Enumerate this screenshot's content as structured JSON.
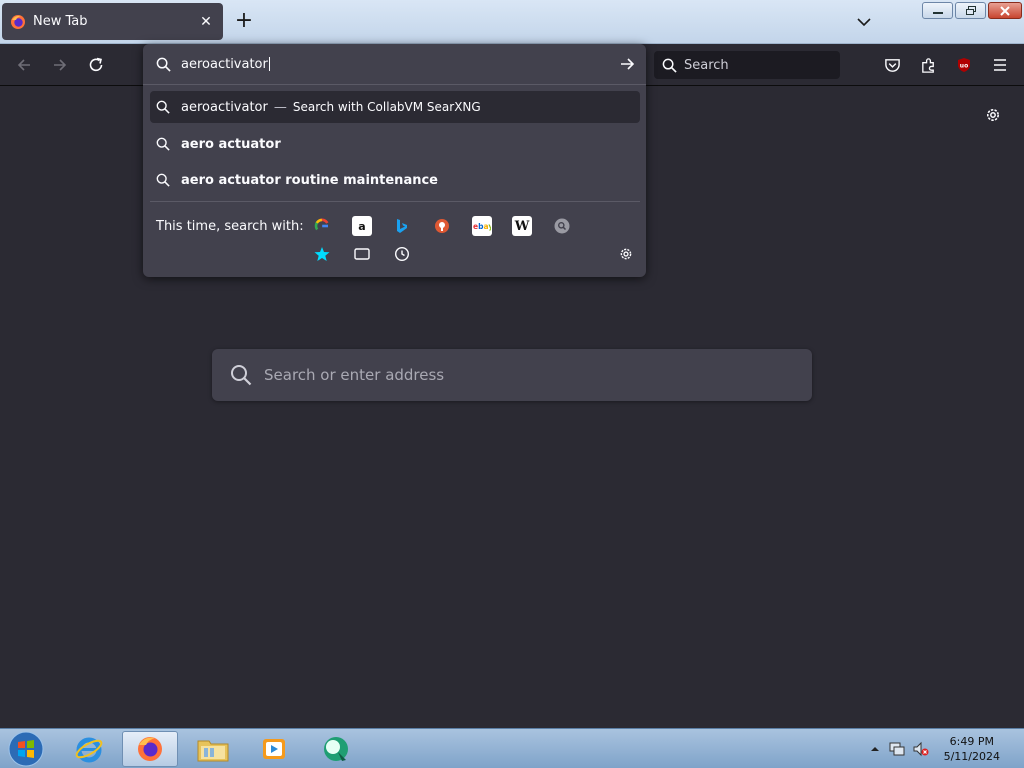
{
  "tab": {
    "title": "New Tab",
    "close_glyph": "✕"
  },
  "new_tab_glyph": "+",
  "toolbar": {
    "search_placeholder": "Search"
  },
  "urlbar": {
    "typed_text": "aeroactivator",
    "suggestions": [
      {
        "text": "aeroactivator",
        "separator": "—",
        "action": "Search with CollabVM SearXNG"
      },
      {
        "text": "aero actuator"
      },
      {
        "text": "aero actuator routine maintenance"
      }
    ],
    "one_off_label": "This time, search with:",
    "engines": [
      "google-icon",
      "amazon-icon",
      "bing-icon",
      "duckduckgo-icon",
      "ebay-icon",
      "wikipedia-icon",
      "searxng-icon"
    ],
    "modes": [
      "bookmarks-icon",
      "tabs-icon",
      "history-icon"
    ]
  },
  "page": {
    "search_placeholder": "Search or enter address"
  },
  "taskbar": {
    "time": "6:49 PM",
    "date": "5/11/2024"
  },
  "colors": {
    "accent": "#00ddff",
    "panel": "#42414d",
    "toolbar": "#2b2a33"
  }
}
